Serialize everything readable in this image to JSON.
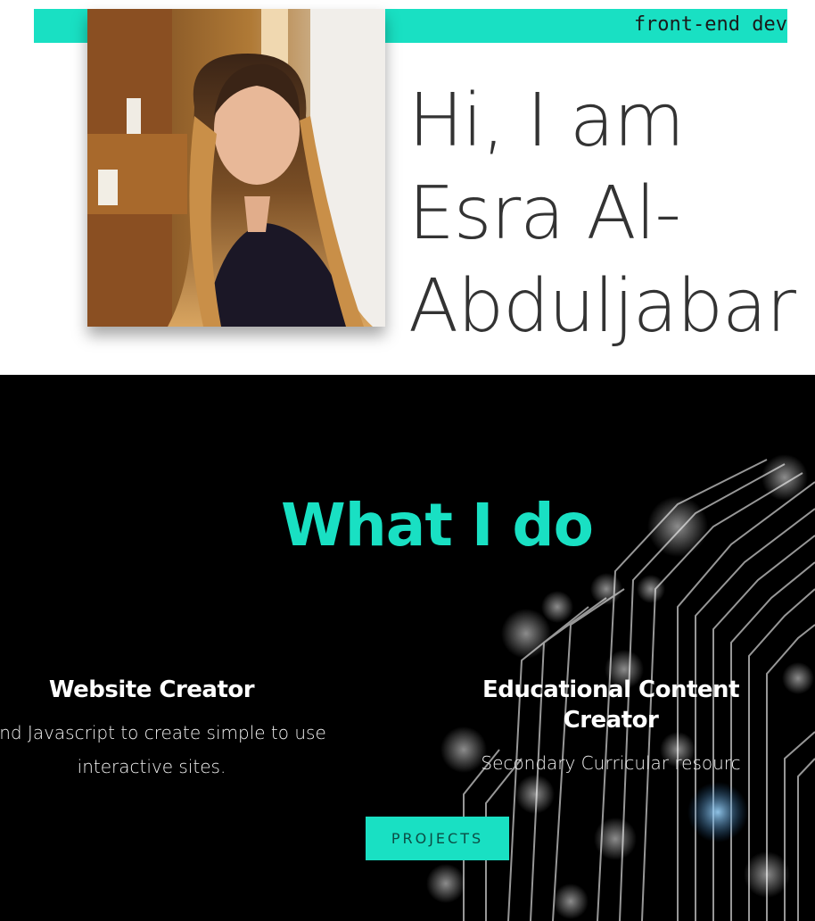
{
  "hero": {
    "tagline": "front-end dev",
    "title_lines": [
      "Hi, I am",
      "Esra Al-",
      "Abduljabar"
    ],
    "portrait": "photo-portrait"
  },
  "what_i_do": {
    "title": "What I do",
    "cards": [
      {
        "title": "Website Creator",
        "description": ", and Javascript to create simple to use interactive sites."
      },
      {
        "title": "Educational Content Creator",
        "description": "Secondary Curricular resourc"
      }
    ],
    "projects_label": "PROJECTS"
  },
  "colors": {
    "accent": "#19e0c3",
    "dark_bg": "#000000",
    "heading_text": "#333333"
  }
}
